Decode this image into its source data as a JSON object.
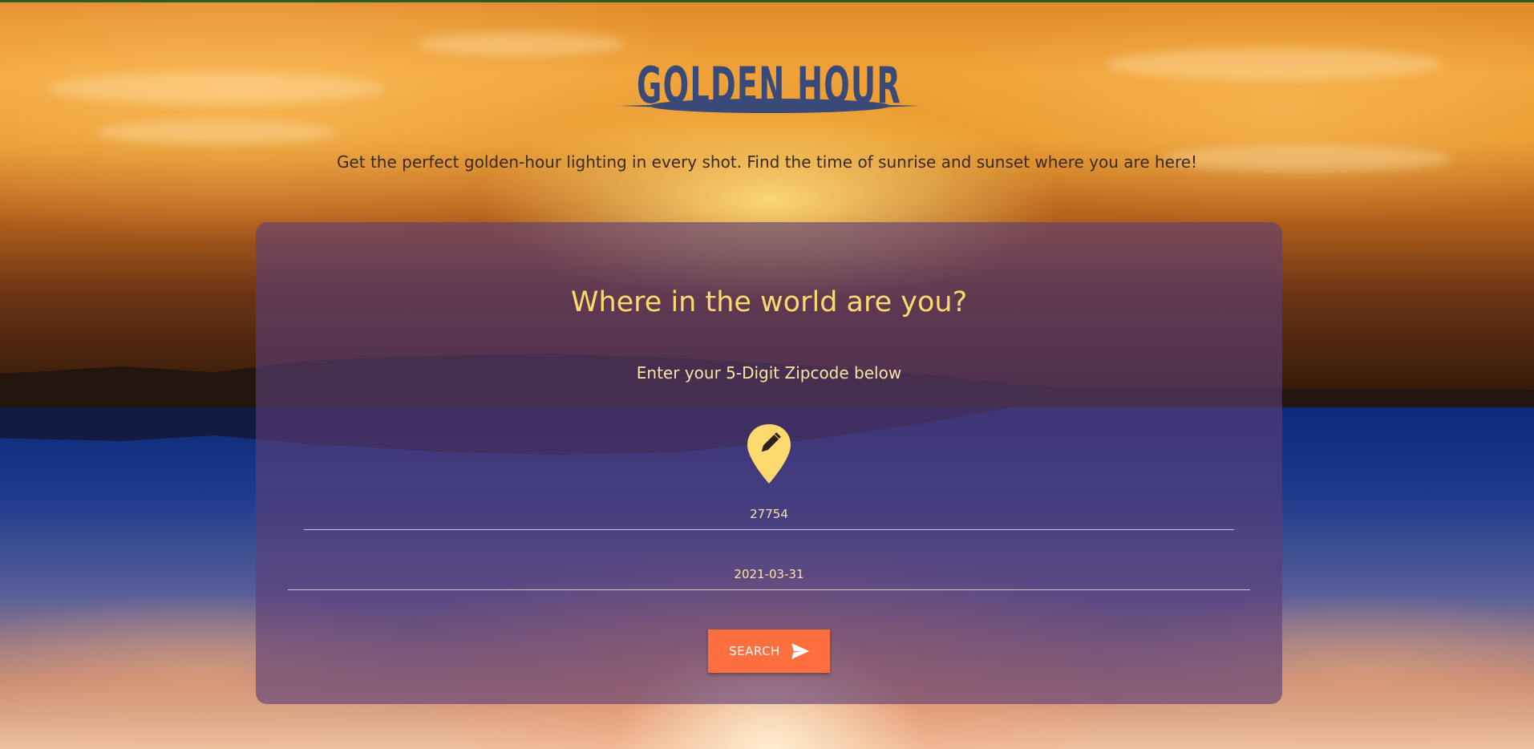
{
  "header": {
    "logo_text": "GOLDEN HOUR",
    "logo_color": "#3a4a78",
    "tagline": "Get the perfect golden-hour lighting in every shot. Find the time of sunrise and sunset where you are here!"
  },
  "card": {
    "title": "Where in the world are you?",
    "subtitle": "Enter your 5-Digit Zipcode below",
    "pin_icon": "map-pin-pencil-icon",
    "zip_value": "27754",
    "date_value": "2021-03-31",
    "search_label": "SEARCH",
    "search_icon": "send-icon"
  },
  "colors": {
    "accent": "#ff6e3f",
    "heading": "#fbd96c",
    "card_overlay": "#5c3e78"
  }
}
